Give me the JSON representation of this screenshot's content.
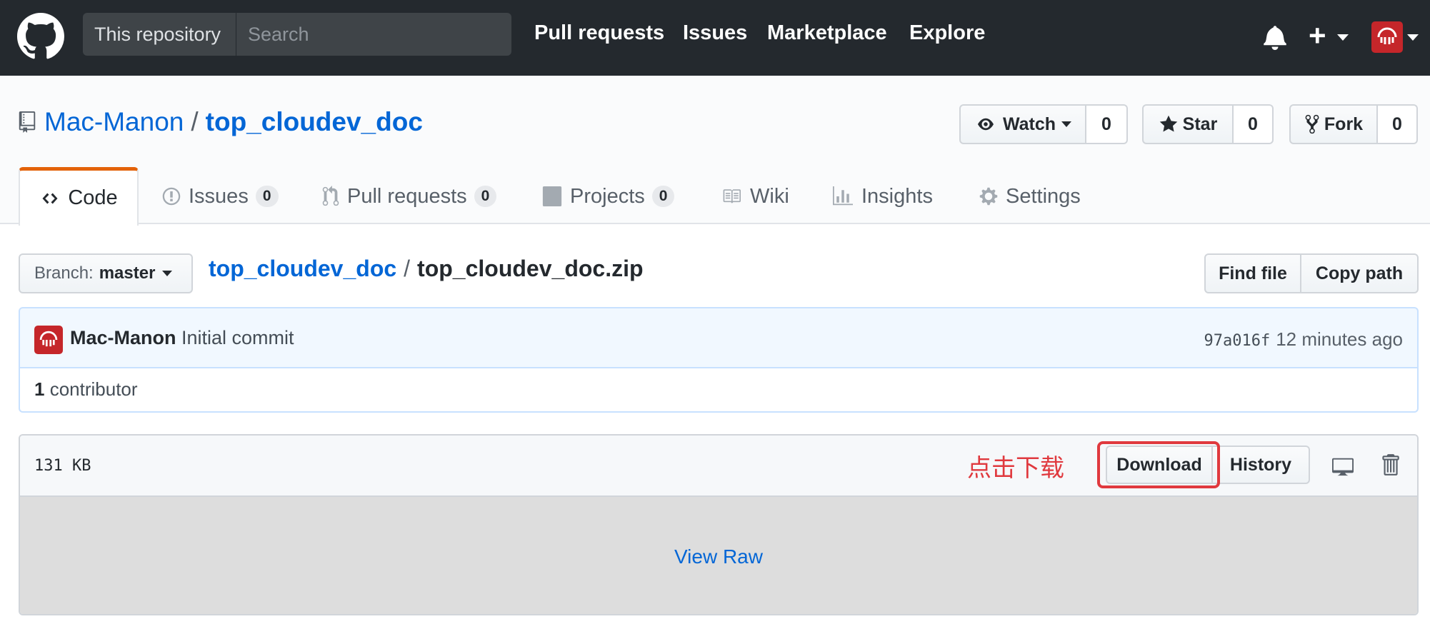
{
  "header": {
    "logo_icon": "github-octocat-icon",
    "search_scope": "This repository",
    "search_placeholder": "Search",
    "nav": [
      "Pull requests",
      "Issues",
      "Marketplace",
      "Explore"
    ],
    "bell_icon": "bell-icon",
    "plus_icon": "plus-icon",
    "avatar_color": "#c5262a"
  },
  "repo": {
    "owner": "Mac-Manon",
    "separator": "/",
    "name": "top_cloudev_doc",
    "watch_label": "Watch",
    "watch_count": "0",
    "star_label": "Star",
    "star_count": "0",
    "fork_label": "Fork",
    "fork_count": "0"
  },
  "tabs": [
    {
      "label": "Code",
      "icon": "code-icon",
      "selected": true
    },
    {
      "label": "Issues",
      "count": "0",
      "icon": "issue-opened-icon"
    },
    {
      "label": "Pull requests",
      "count": "0",
      "icon": "git-pull-request-icon"
    },
    {
      "label": "Projects",
      "count": "0",
      "icon": "project-icon"
    },
    {
      "label": "Wiki",
      "icon": "book-icon"
    },
    {
      "label": "Insights",
      "icon": "graph-icon"
    },
    {
      "label": "Settings",
      "icon": "gear-icon"
    }
  ],
  "file_nav": {
    "branch_label": "Branch:",
    "branch_value": "master",
    "breadcrumb_root": "top_cloudev_doc",
    "breadcrumb_sep": "/",
    "breadcrumb_file": "top_cloudev_doc.zip",
    "find_file": "Find file",
    "copy_path": "Copy path"
  },
  "commit": {
    "author": "Mac-Manon",
    "message": "Initial commit",
    "sha": "97a016f",
    "time": "12 minutes ago",
    "contributors_count": "1",
    "contributors_label": "contributor"
  },
  "file": {
    "size": "131 KB",
    "annotation": "点击下载",
    "download_label": "Download",
    "history_label": "History",
    "desktop_icon": "desktop-icon",
    "trash_icon": "trash-icon",
    "view_raw": "View Raw",
    "highlight_color": "#e0393e"
  }
}
